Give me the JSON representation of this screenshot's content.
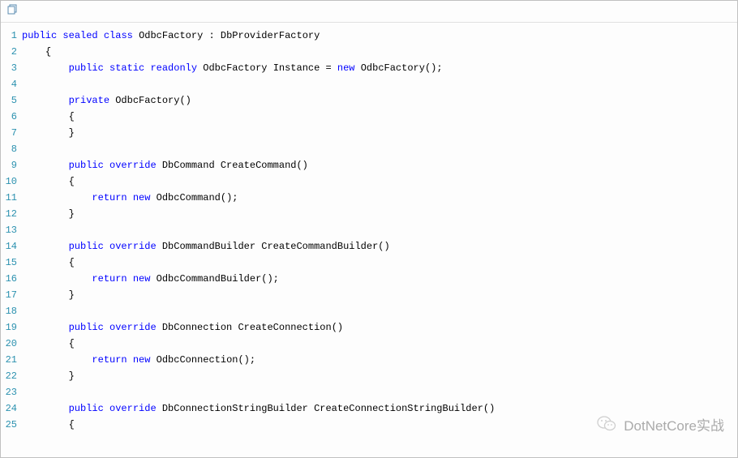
{
  "toolbar": {
    "copy_icon_title": "Copy"
  },
  "watermark": {
    "text": "DotNetCore实战"
  },
  "code": {
    "lines": [
      {
        "n": 1,
        "indent": 0,
        "tokens": [
          [
            "kw",
            "public"
          ],
          [
            "sp",
            " "
          ],
          [
            "kw",
            "sealed"
          ],
          [
            "sp",
            " "
          ],
          [
            "kw",
            "class"
          ],
          [
            "sp",
            " "
          ],
          [
            "typ",
            "OdbcFactory"
          ],
          [
            "sp",
            " "
          ],
          [
            "punc",
            ":"
          ],
          [
            "sp",
            " "
          ],
          [
            "typ",
            "DbProviderFactory"
          ]
        ]
      },
      {
        "n": 2,
        "indent": 1,
        "tokens": [
          [
            "punc",
            "{"
          ]
        ]
      },
      {
        "n": 3,
        "indent": 2,
        "tokens": [
          [
            "kw",
            "public"
          ],
          [
            "sp",
            " "
          ],
          [
            "kw",
            "static"
          ],
          [
            "sp",
            " "
          ],
          [
            "kw",
            "readonly"
          ],
          [
            "sp",
            " "
          ],
          [
            "typ",
            "OdbcFactory"
          ],
          [
            "sp",
            " "
          ],
          [
            "typ",
            "Instance"
          ],
          [
            "sp",
            " "
          ],
          [
            "punc",
            "="
          ],
          [
            "sp",
            " "
          ],
          [
            "kw",
            "new"
          ],
          [
            "sp",
            " "
          ],
          [
            "typ",
            "OdbcFactory"
          ],
          [
            "punc",
            "();"
          ]
        ]
      },
      {
        "n": 4,
        "indent": 0,
        "tokens": []
      },
      {
        "n": 5,
        "indent": 2,
        "tokens": [
          [
            "kw",
            "private"
          ],
          [
            "sp",
            " "
          ],
          [
            "typ",
            "OdbcFactory"
          ],
          [
            "punc",
            "()"
          ]
        ]
      },
      {
        "n": 6,
        "indent": 2,
        "tokens": [
          [
            "punc",
            "{"
          ]
        ]
      },
      {
        "n": 7,
        "indent": 2,
        "tokens": [
          [
            "punc",
            "}"
          ]
        ]
      },
      {
        "n": 8,
        "indent": 0,
        "tokens": []
      },
      {
        "n": 9,
        "indent": 2,
        "tokens": [
          [
            "kw",
            "public"
          ],
          [
            "sp",
            " "
          ],
          [
            "kw",
            "override"
          ],
          [
            "sp",
            " "
          ],
          [
            "typ",
            "DbCommand"
          ],
          [
            "sp",
            " "
          ],
          [
            "typ",
            "CreateCommand"
          ],
          [
            "punc",
            "()"
          ]
        ]
      },
      {
        "n": 10,
        "indent": 2,
        "tokens": [
          [
            "punc",
            "{"
          ]
        ]
      },
      {
        "n": 11,
        "indent": 3,
        "tokens": [
          [
            "kw",
            "return"
          ],
          [
            "sp",
            " "
          ],
          [
            "kw",
            "new"
          ],
          [
            "sp",
            " "
          ],
          [
            "typ",
            "OdbcCommand"
          ],
          [
            "punc",
            "();"
          ]
        ]
      },
      {
        "n": 12,
        "indent": 2,
        "tokens": [
          [
            "punc",
            "}"
          ]
        ]
      },
      {
        "n": 13,
        "indent": 0,
        "tokens": []
      },
      {
        "n": 14,
        "indent": 2,
        "tokens": [
          [
            "kw",
            "public"
          ],
          [
            "sp",
            " "
          ],
          [
            "kw",
            "override"
          ],
          [
            "sp",
            " "
          ],
          [
            "typ",
            "DbCommandBuilder"
          ],
          [
            "sp",
            " "
          ],
          [
            "typ",
            "CreateCommandBuilder"
          ],
          [
            "punc",
            "()"
          ]
        ]
      },
      {
        "n": 15,
        "indent": 2,
        "tokens": [
          [
            "punc",
            "{"
          ]
        ]
      },
      {
        "n": 16,
        "indent": 3,
        "tokens": [
          [
            "kw",
            "return"
          ],
          [
            "sp",
            " "
          ],
          [
            "kw",
            "new"
          ],
          [
            "sp",
            " "
          ],
          [
            "typ",
            "OdbcCommandBuilder"
          ],
          [
            "punc",
            "();"
          ]
        ]
      },
      {
        "n": 17,
        "indent": 2,
        "tokens": [
          [
            "punc",
            "}"
          ]
        ]
      },
      {
        "n": 18,
        "indent": 0,
        "tokens": []
      },
      {
        "n": 19,
        "indent": 2,
        "tokens": [
          [
            "kw",
            "public"
          ],
          [
            "sp",
            " "
          ],
          [
            "kw",
            "override"
          ],
          [
            "sp",
            " "
          ],
          [
            "typ",
            "DbConnection"
          ],
          [
            "sp",
            " "
          ],
          [
            "typ",
            "CreateConnection"
          ],
          [
            "punc",
            "()"
          ]
        ]
      },
      {
        "n": 20,
        "indent": 2,
        "tokens": [
          [
            "punc",
            "{"
          ]
        ]
      },
      {
        "n": 21,
        "indent": 3,
        "tokens": [
          [
            "kw",
            "return"
          ],
          [
            "sp",
            " "
          ],
          [
            "kw",
            "new"
          ],
          [
            "sp",
            " "
          ],
          [
            "typ",
            "OdbcConnection"
          ],
          [
            "punc",
            "();"
          ]
        ]
      },
      {
        "n": 22,
        "indent": 2,
        "tokens": [
          [
            "punc",
            "}"
          ]
        ]
      },
      {
        "n": 23,
        "indent": 0,
        "tokens": []
      },
      {
        "n": 24,
        "indent": 2,
        "tokens": [
          [
            "kw",
            "public"
          ],
          [
            "sp",
            " "
          ],
          [
            "kw",
            "override"
          ],
          [
            "sp",
            " "
          ],
          [
            "typ",
            "DbConnectionStringBuilder"
          ],
          [
            "sp",
            " "
          ],
          [
            "typ",
            "CreateConnectionStringBuilder"
          ],
          [
            "punc",
            "()"
          ]
        ]
      },
      {
        "n": 25,
        "indent": 2,
        "tokens": [
          [
            "punc",
            "{"
          ]
        ]
      }
    ]
  }
}
